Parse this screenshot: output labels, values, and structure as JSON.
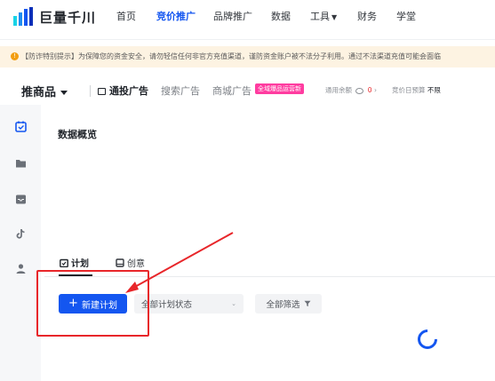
{
  "brand": {
    "name": "巨量千川"
  },
  "topnav": [
    "首页",
    "竞价推广",
    "品牌推广",
    "数据",
    "工具",
    "财务",
    "学堂"
  ],
  "banner": {
    "text": "【防诈特别提示】为保障您的资金安全，请勿轻信任何非官方充值渠道，谨防资金账户被不法分子利用。通过不法渠道充值可能会面临"
  },
  "toolbar": {
    "product": "推商品",
    "ad_main": "通投广告",
    "ad_search": "搜索广告",
    "ad_mall": "商城广告",
    "badge_new": "全域爆品运营新",
    "balance_label": "通用余额",
    "balance_value": "0",
    "budget_label": "竞价日预算",
    "budget_value": "不限"
  },
  "section": {
    "title": "数据概览"
  },
  "tabs": [
    {
      "label": "计划",
      "active": true
    },
    {
      "label": "创意",
      "active": false
    }
  ],
  "actions": {
    "new_plan": "新建计划",
    "status_filter": "全部计划状态",
    "all_filter": "全部筛选"
  },
  "colors": {
    "accent": "#1456f0",
    "highlight": "#e8262a",
    "badge": "#ff3ca0"
  }
}
